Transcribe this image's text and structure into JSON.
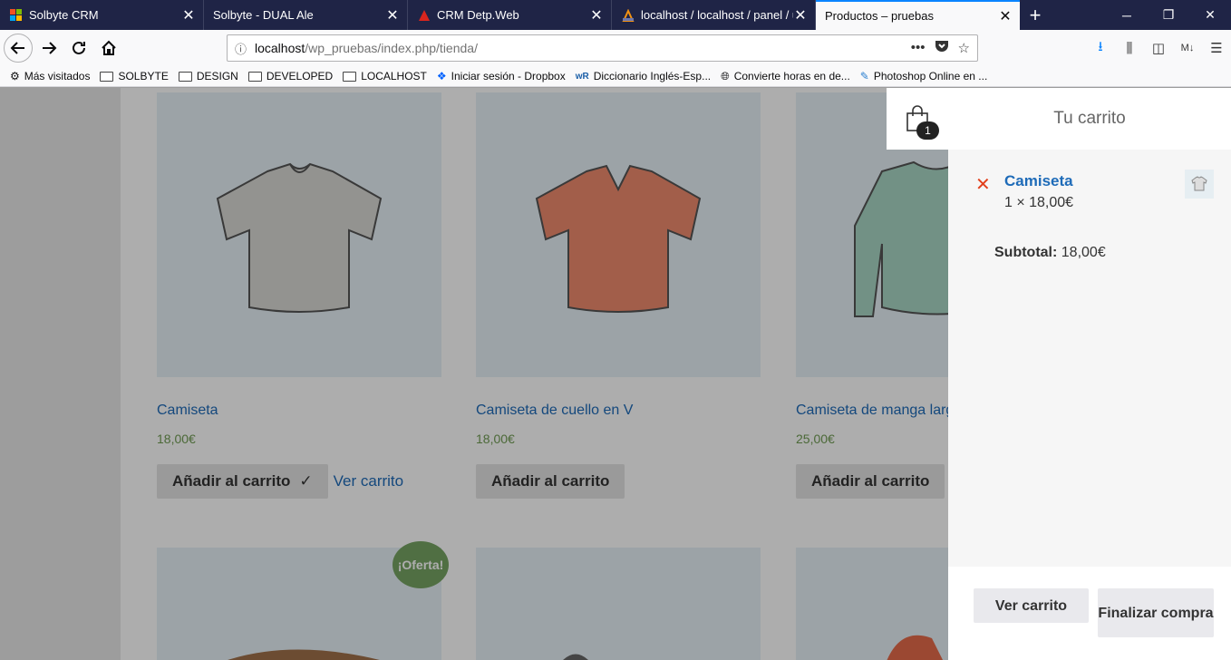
{
  "tabs": [
    {
      "title": "Solbyte CRM",
      "icon": "windows-icon"
    },
    {
      "title": "Solbyte - DUAL Ale",
      "icon": "none"
    },
    {
      "title": "CRM Detp.Web",
      "icon": "red-triangle-icon"
    },
    {
      "title": "localhost / localhost / panel / u",
      "icon": "phpmyadmin-icon"
    },
    {
      "title": "Productos – pruebas",
      "icon": "none",
      "active": true
    }
  ],
  "url": {
    "host": "localhost",
    "path": "/wp_pruebas/index.php/tienda/"
  },
  "bookmarks": [
    {
      "label": "Más visitados",
      "icon": "gear-icon"
    },
    {
      "label": "SOLBYTE",
      "icon": "folder-icon"
    },
    {
      "label": "DESIGN",
      "icon": "folder-icon"
    },
    {
      "label": "DEVELOPED",
      "icon": "folder-icon"
    },
    {
      "label": "LOCALHOST",
      "icon": "folder-icon"
    },
    {
      "label": "Iniciar sesión - Dropbox",
      "icon": "dropbox-icon"
    },
    {
      "label": "Diccionario Inglés-Esp...",
      "icon": "wr-icon"
    },
    {
      "label": "Convierte horas en de...",
      "icon": "globe-icon"
    },
    {
      "label": "Photoshop Online en ...",
      "icon": "feather-icon"
    }
  ],
  "products": [
    {
      "name": "Camiseta",
      "price": "18,00€",
      "button": "Añadir al carrito",
      "added": true,
      "view_cart": "Ver carrito",
      "color": "#d9d9d5"
    },
    {
      "name": "Camiseta de cuello en V",
      "price": "18,00€",
      "button": "Añadir al carrito",
      "added": false,
      "color": "#ef8b6e"
    },
    {
      "name": "Camiseta de manga larga",
      "price": "25,00€",
      "button": "Añadir al carrito",
      "added": false,
      "color": "#a8d6c4"
    }
  ],
  "sale_badge": "¡Oferta!",
  "cart": {
    "count": "1",
    "title": "Tu carrito",
    "item_name": "Camiseta",
    "item_qty": "1 × 18,00€",
    "subtotal_label": "Subtotal:",
    "subtotal_value": "18,00€",
    "view_cart": "Ver carrito",
    "checkout": "Finalizar compra"
  }
}
